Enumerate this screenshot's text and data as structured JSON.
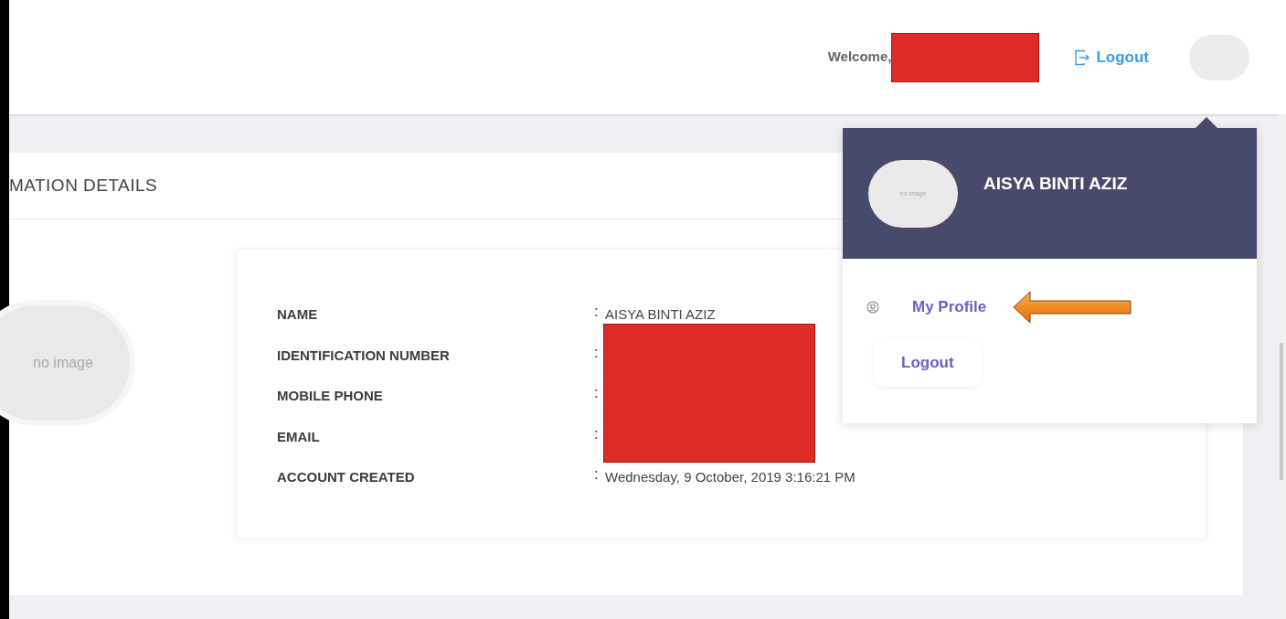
{
  "header": {
    "welcome": "Welcome,",
    "welcome_redacted": true,
    "logout": "Logout"
  },
  "card": {
    "title": "MATION DETAILS",
    "avatar_text": "no image",
    "rows": [
      {
        "label": "NAME",
        "separator": ":",
        "value": "AISYA BINTI AZIZ",
        "redacted": false
      },
      {
        "label": "IDENTIFICATION NUMBER",
        "separator": ":",
        "redacted": true
      },
      {
        "label": "MOBILE PHONE",
        "separator": ":",
        "redacted": true
      },
      {
        "label": "EMAIL",
        "separator": ":",
        "redacted": true
      },
      {
        "label": "ACCOUNT CREATED",
        "separator": ":",
        "value": "Wednesday, 9 October, 2019 3:16:21 PM",
        "redacted": false
      }
    ]
  },
  "dropdown": {
    "open": true,
    "avatar_text": "no image",
    "name": "AISYA BINTI AZIZ",
    "items": [
      {
        "kind": "link",
        "label": "My Profile",
        "highlighted": true
      },
      {
        "kind": "button",
        "label": "Logout",
        "highlighted": false
      }
    ]
  }
}
